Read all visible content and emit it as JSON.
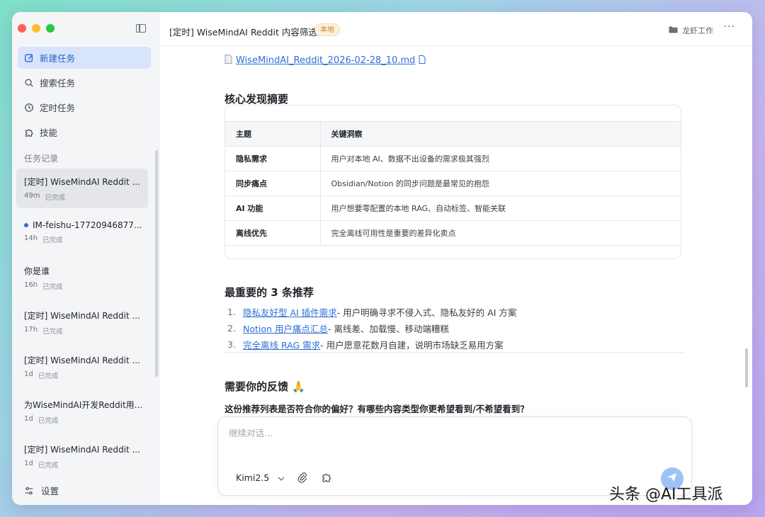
{
  "sidebar": {
    "nav": {
      "new_task": "新建任务",
      "search_task": "搜索任务",
      "scheduled_task": "定时任务",
      "skills": "技能"
    },
    "section_title": "任务记录",
    "tasks": [
      {
        "title": "[定时] WiseMindAI Reddit ...",
        "ago": "49m",
        "status": "已完成"
      },
      {
        "title": "IM-feishu-17720946877...",
        "ago": "14h",
        "status": "已完成"
      },
      {
        "title": "你是谁",
        "ago": "16h",
        "status": "已完成"
      },
      {
        "title": "[定时] WiseMindAI Reddit ...",
        "ago": "17h",
        "status": "已完成"
      },
      {
        "title": "[定时] WiseMindAI Reddit ...",
        "ago": "1d",
        "status": "已完成"
      },
      {
        "title": "为WiseMindAI开发Reddit用...",
        "ago": "1d",
        "status": "已完成"
      },
      {
        "title": "[定时] WiseMindAI Reddit ...",
        "ago": "1d",
        "status": "已完成"
      }
    ],
    "settings": "设置"
  },
  "header": {
    "title": "[定时] WiseMindAI Reddit 内容筛选",
    "badge": "本地",
    "workspace": "龙虾工作",
    "more": "···"
  },
  "content": {
    "file_name": "WiseMindAI_Reddit_2026-02-28_10.md",
    "summary_heading": "核心发现摘要",
    "table": {
      "headers": [
        "主题",
        "关键洞察"
      ],
      "rows": [
        [
          "隐私需求",
          "用户对本地 AI、数据不出设备的需求极其强烈"
        ],
        [
          "同步痛点",
          "Obsidian/Notion 的同步问题是最常见的抱怨"
        ],
        [
          "AI 功能",
          "用户想要零配置的本地 RAG、自动标签、智能关联"
        ],
        [
          "离线优先",
          "完全离线可用性是重要的差异化卖点"
        ]
      ]
    },
    "rec_heading": "最重要的 3 条推荐",
    "recommendations": [
      {
        "num": "1.",
        "link": "隐私友好型 AI 插件需求",
        "desc": " - 用户明确寻求不侵入式、隐私友好的 AI 方案"
      },
      {
        "num": "2.",
        "link": "Notion 用户痛点汇总",
        "desc": " - 离线差、加载慢、移动端糟糕"
      },
      {
        "num": "3.",
        "link": "完全离线 RAG 需求",
        "desc": " - 用户愿意花数月自建，说明市场缺乏易用方案"
      }
    ],
    "feedback_heading": "需要你的反馈 🙏",
    "question": "这份推荐列表是否符合你的偏好？有哪些内容类型你更希望看到/不希望看到？"
  },
  "composer": {
    "placeholder": "继续对话...",
    "model": "Kimi2.5"
  },
  "watermark": "头条 @AI工具派"
}
